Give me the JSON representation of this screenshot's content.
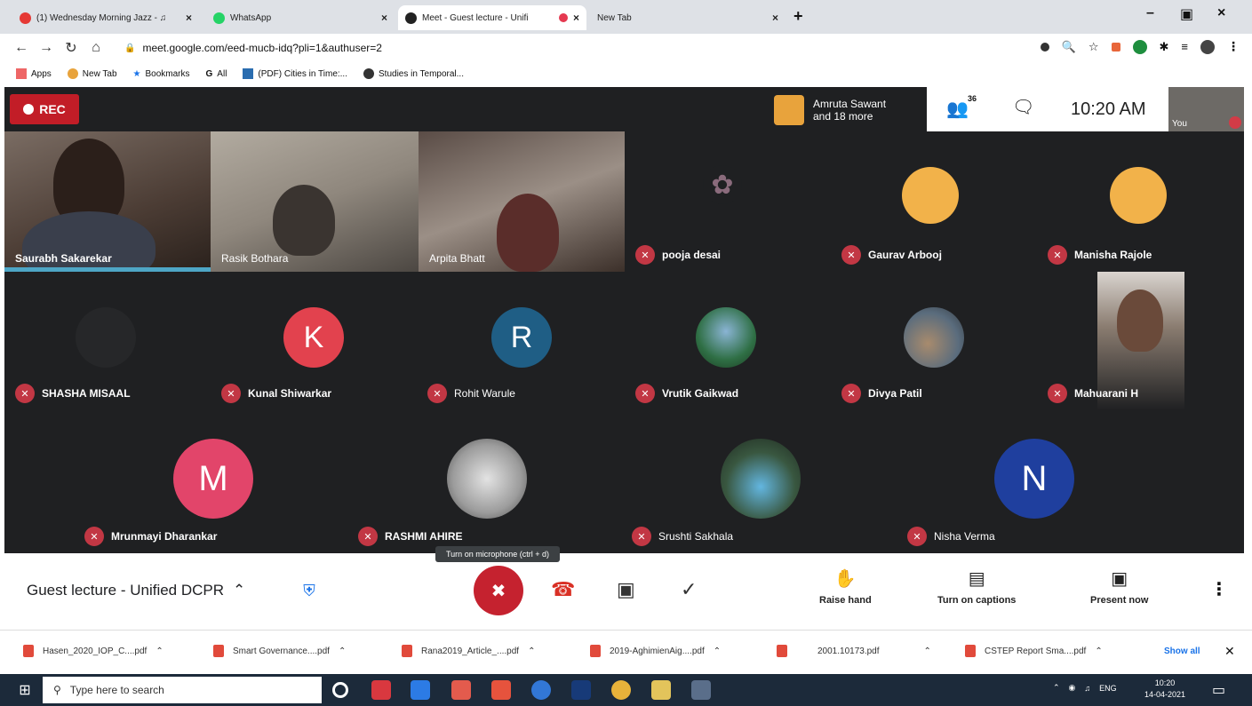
{
  "browser": {
    "tabs": [
      {
        "title": "(1) Wednesday Morning Jazz - ♫",
        "favicon_color": "#e53935",
        "close": "×"
      },
      {
        "title": "WhatsApp",
        "favicon_color": "#25d366",
        "close": "×"
      },
      {
        "title": "Meet - Guest lecture - Unifi",
        "favicon_color": "#222222",
        "close": "×"
      },
      {
        "title": "New Tab",
        "favicon_color": "#dee1e6",
        "close": "×"
      }
    ],
    "new_tab": "+",
    "window_controls": {
      "minimize": "–",
      "maximize": "▣",
      "close": "×"
    },
    "nav": {
      "back": "←",
      "forward": "→",
      "reload": "↻",
      "home": "⌂"
    },
    "url": "meet.google.com/eed-mucb-idq?pli=1&authuser=2",
    "bookmarks": [
      {
        "label": "Apps",
        "icon": "apps-grid-icon"
      },
      {
        "label": "New Tab",
        "icon": "new-tab-icon"
      },
      {
        "label": "Bookmarks",
        "icon": "star-icon"
      },
      {
        "label": "All",
        "icon": "google-icon"
      },
      {
        "label": "(PDF) Cities in Time:...",
        "icon": "page-icon"
      },
      {
        "label": "Studies in Temporal...",
        "icon": "page-icon"
      }
    ]
  },
  "meet": {
    "rec_label": "REC",
    "presenter_panel": {
      "name": "Amruta Sawant",
      "more": "and 18 more"
    },
    "people_count": "36",
    "time": "10:20 AM",
    "self_label": "You",
    "video_tiles": [
      {
        "name": "Saurabh Sakarekar"
      },
      {
        "name": "Rasik Bothara"
      },
      {
        "name": "Arpita Bhatt"
      }
    ],
    "participants_row1": [
      {
        "name": "pooja desai"
      },
      {
        "name": "Gaurav Arbooj"
      },
      {
        "name": "Manisha Rajole"
      }
    ],
    "participants_row2": [
      {
        "name": "SHASHA MISAAL",
        "letter": ""
      },
      {
        "name": "Kunal Shiwarkar",
        "letter": "K",
        "color": "#e2424e"
      },
      {
        "name": "Rohit Warule",
        "letter": "R",
        "color": "#1f5e85"
      },
      {
        "name": "Vrutik Gaikwad",
        "letter": ""
      },
      {
        "name": "Divya Patil",
        "letter": ""
      },
      {
        "name": "Mahuarani H",
        "letter": ""
      }
    ],
    "participants_row3": [
      {
        "name": "Mrunmayi Dharankar",
        "letter": "M",
        "color": "#e2456a"
      },
      {
        "name": "RASHMI AHIRE",
        "letter": ""
      },
      {
        "name": "Srushti Sakhala",
        "letter": ""
      },
      {
        "name": "Nisha Verma",
        "letter": "N",
        "color": "#1f3f9e"
      }
    ],
    "tooltip": "Turn on microphone (ctrl + d)",
    "meeting_title": "Guest lecture - Unified DCPR",
    "actions": {
      "raise_hand": "Raise hand",
      "captions": "Turn on captions",
      "present": "Present now"
    }
  },
  "downloads": {
    "files": [
      "Hasen_2020_IOP_C....pdf",
      "Smart Governance....pdf",
      "Rana2019_Article_....pdf",
      "2019-AghimienAig....pdf",
      "2001.10173.pdf",
      "CSTEP Report Sma....pdf"
    ],
    "show_all": "Show all"
  },
  "taskbar": {
    "search_placeholder": "Type here to search",
    "lang": "ENG",
    "clock_time": "10:20",
    "clock_date": "14-04-2021"
  }
}
